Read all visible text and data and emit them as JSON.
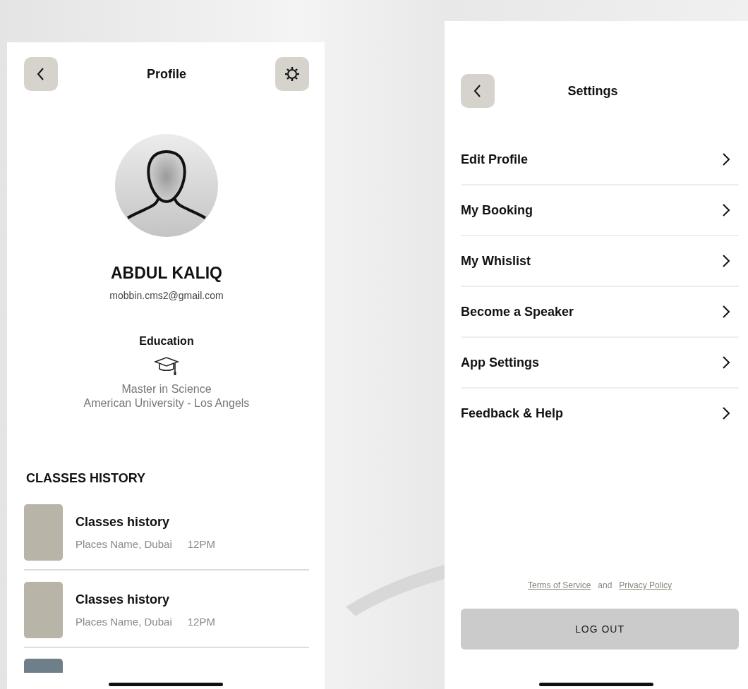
{
  "profile_screen": {
    "title": "Profile",
    "name": "ABDUL KALIQ",
    "email": "mobbin.cms2@gmail.com",
    "education": {
      "heading": "Education",
      "degree": "Master in Science",
      "school": "American University - Los Angels"
    },
    "classes_heading": "CLASSES HISTORY",
    "classes": [
      {
        "title": "Classes history",
        "place": "Places Name, Dubai",
        "time": "12PM"
      },
      {
        "title": "Classes history",
        "place": "Places Name, Dubai",
        "time": "12PM"
      }
    ]
  },
  "settings_screen": {
    "title": "Settings",
    "items": [
      {
        "label": "Edit Profile"
      },
      {
        "label": "My Booking"
      },
      {
        "label": "My Whislist"
      },
      {
        "label": "Become a Speaker"
      },
      {
        "label": "App Settings"
      },
      {
        "label": "Feedback & Help"
      }
    ],
    "legal": {
      "terms": "Terms of Service",
      "conjunction": "and",
      "privacy": "Privacy Policy"
    },
    "logout": "LOG OUT"
  }
}
